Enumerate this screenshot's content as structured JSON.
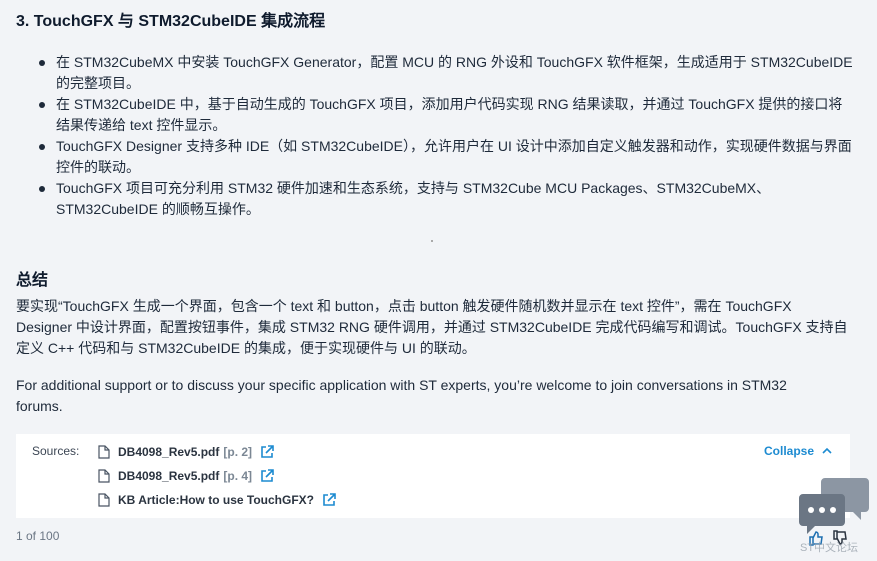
{
  "section": {
    "title": "3. TouchGFX 与 STM32CubeIDE 集成流程",
    "bullets": [
      "在 STM32CubeMX 中安装 TouchGFX Generator，配置 MCU 的 RNG 外设和 TouchGFX 软件框架，生成适用于 STM32CubeIDE 的完整项目。",
      "在 STM32CubeIDE 中，基于自动生成的 TouchGFX 项目，添加用户代码实现 RNG 结果读取，并通过 TouchGFX 提供的接口将结果传递给 text 控件显示。",
      "TouchGFX Designer 支持多种 IDE（如 STM32CubeIDE），允许用户在 UI 设计中添加自定义触发器和动作，实现硬件数据与界面控件的联动。",
      "TouchGFX 项目可充分利用 STM32 硬件加速和生态系统，支持与 STM32Cube MCU Packages、STM32CubeMX、STM32CubeIDE 的顺畅互操作。"
    ]
  },
  "summary": {
    "title": "总结",
    "text": "要实现“TouchGFX 生成一个界面，包含一个 text 和 button，点击 button 触发硬件随机数并显示在 text 控件”，需在 TouchGFX Designer 中设计界面，配置按钮事件，集成 STM32 RNG 硬件调用，并通过 STM32CubeIDE 完成代码编写和调试。TouchGFX 支持自定义 C++ 代码和与 STM32CubeIDE 的集成，便于实现硬件与 UI 的联动。"
  },
  "support": {
    "text": "For additional support or to discuss your specific application with ST experts, you’re welcome to join conversations in STM32 forums."
  },
  "sources": {
    "label": "Sources:",
    "collapse_label": "Collapse",
    "items": [
      {
        "name": "DB4098_Rev5.pdf",
        "page": "[p. 2]"
      },
      {
        "name": "DB4098_Rev5.pdf",
        "page": "[p. 4]"
      },
      {
        "name": "KB Article:How to use TouchGFX?",
        "page": ""
      }
    ]
  },
  "pager": {
    "text": "1 of 100"
  },
  "watermark": {
    "text": "ST中文论坛"
  },
  "colors": {
    "accent": "#1d8bd1",
    "background": "#f2f4f7",
    "text": "#1e2a3a"
  },
  "icons": [
    "document-icon",
    "external-link-icon",
    "chevron-up-icon",
    "chat-bubble-icon",
    "thumbs-up-icon",
    "thumbs-down-icon"
  ]
}
